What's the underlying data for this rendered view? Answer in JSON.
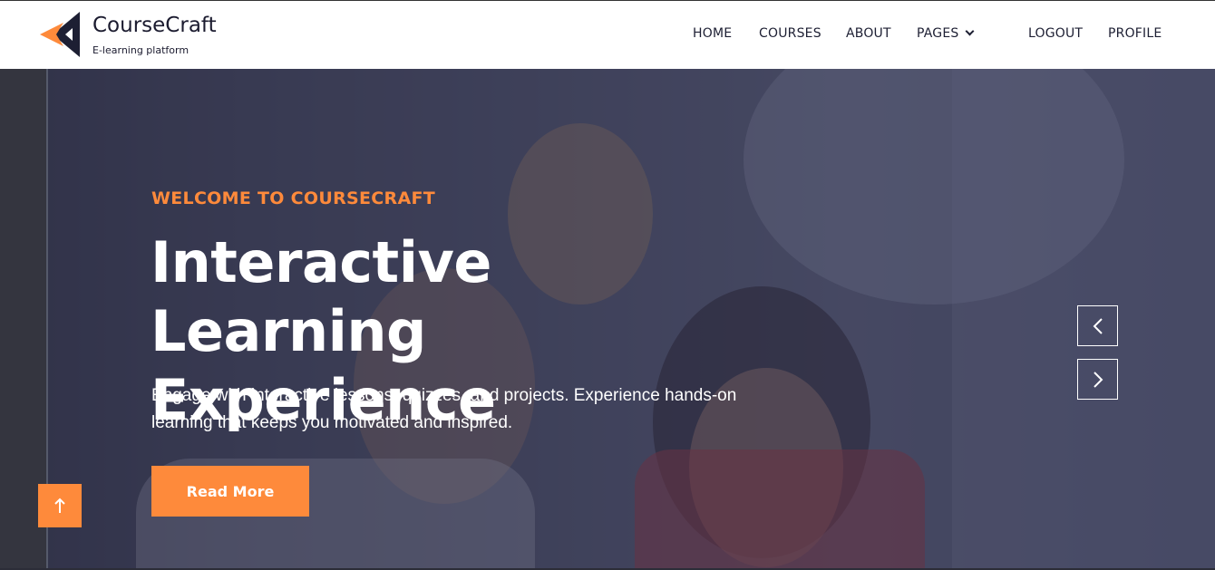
{
  "brand": {
    "name": "CourseCraft",
    "tagline": "E-learning platform",
    "colors": {
      "primary": "#fe8a3b",
      "dark": "#1d1f33"
    }
  },
  "nav": {
    "home": "HOME",
    "courses": "COURSES",
    "about": "ABOUT",
    "pages": "PAGES",
    "logout": "LOGOUT",
    "profile": "PROFILE"
  },
  "hero": {
    "eyebrow": "WELCOME TO COURSECRAFT",
    "headline": "Interactive Learning Experience",
    "description": "Engage with interactive lessons, quizzes, and projects. Experience hands-on learning that keeps you motivated and inspired.",
    "cta_label": "Read More"
  },
  "icons": {
    "prev": "chevron-left-icon",
    "next": "chevron-right-icon",
    "back_to_top": "arrow-up-icon",
    "pages_dropdown": "chevron-down-icon"
  }
}
